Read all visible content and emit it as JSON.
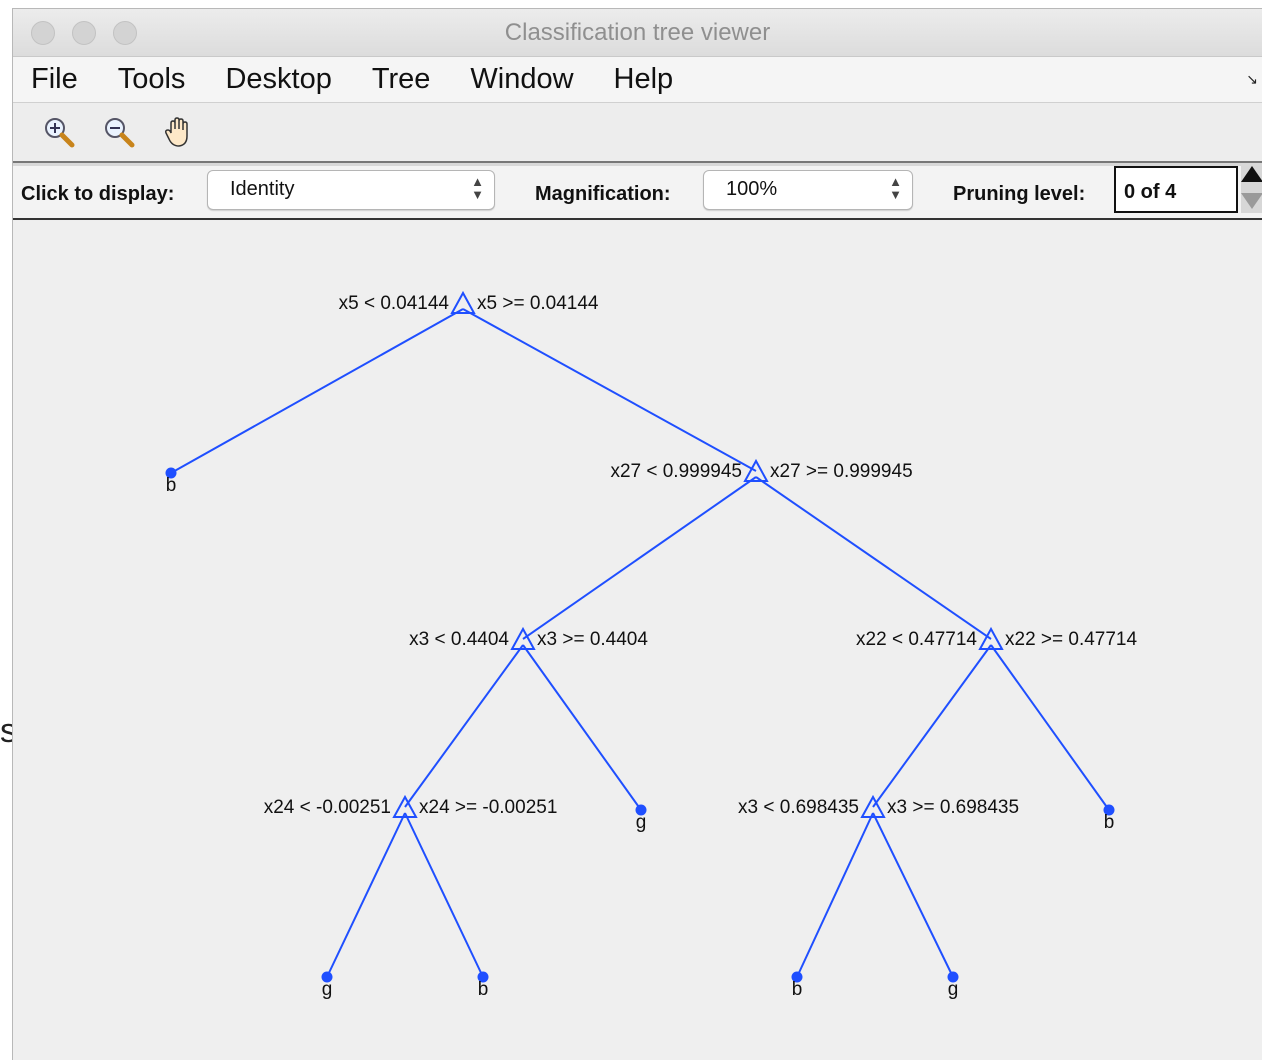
{
  "stray_glyph": "s",
  "window": {
    "title": "Classification tree viewer"
  },
  "menu": [
    "File",
    "Tools",
    "Desktop",
    "Tree",
    "Window",
    "Help"
  ],
  "menu_overflow_icon": "arrow-icon",
  "toolbar": {
    "buttons": [
      "zoom-in-icon",
      "zoom-out-icon",
      "pan-hand-icon"
    ]
  },
  "controls": {
    "display_label": "Click to display:",
    "display_value": "Identity",
    "magnification_label": "Magnification:",
    "magnification_value": "100%",
    "pruning_label": "Pruning level:",
    "pruning_value": "0 of 4"
  },
  "tree": {
    "color": "#1f4fff",
    "splits": [
      {
        "left_rule": "x5 < 0.04144",
        "right_rule": "x5 >= 0.04144"
      },
      {
        "left_rule": "x27 < 0.999945",
        "right_rule": "x27 >= 0.999945"
      },
      {
        "left_rule": "x3 < 0.4404",
        "right_rule": "x3 >= 0.4404"
      },
      {
        "left_rule": "x22 < 0.47714",
        "right_rule": "x22 >= 0.47714"
      },
      {
        "left_rule": "x24 < -0.00251",
        "right_rule": "x24 >= -0.00251"
      },
      {
        "left_rule": "x3 < 0.698435",
        "right_rule": "x3 >= 0.698435"
      }
    ],
    "leaves": [
      "b",
      "g",
      "b",
      "g",
      "b",
      "b",
      "g"
    ]
  }
}
